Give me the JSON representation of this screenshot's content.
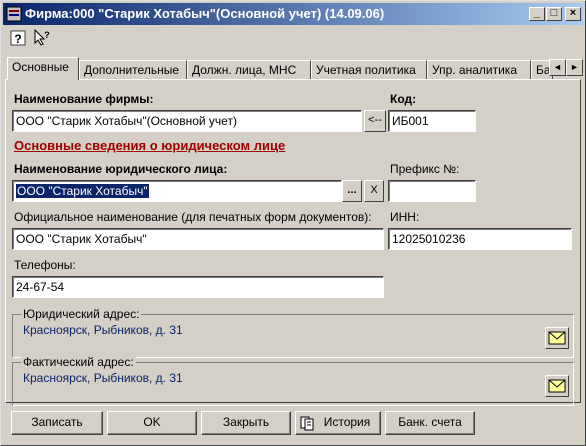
{
  "window": {
    "title": "Фирма:000 \"Старик Хотабыч\"(Основной учет) (14.09.06)"
  },
  "toolbar": {
    "help_icon": "question-icon",
    "whatsthis_icon": "pointer-question-icon"
  },
  "tabs": [
    {
      "label": "Основные",
      "active": true
    },
    {
      "label": "Дополнительные",
      "active": false
    },
    {
      "label": "Должн. лица, МНС",
      "active": false
    },
    {
      "label": "Учетная политика",
      "active": false
    },
    {
      "label": "Упр. аналитика",
      "active": false
    },
    {
      "label": "Ба",
      "active": false
    }
  ],
  "form": {
    "firm_name_label": "Наименование фирмы:",
    "firm_name_value": "ООО \"Старик Хотабыч\"(Основной учет)",
    "copy_button": "<--",
    "code_label": "Код:",
    "code_value": "ИБ001",
    "section_heading": "Основные сведения о юридическом лице",
    "legal_name_label": "Наименование юридического лица:",
    "legal_name_value": "ООО \"Старик Хотабыч\"",
    "select_button": "...",
    "clear_button": "X",
    "prefix_label": "Префикс №:",
    "prefix_value": "",
    "official_name_label": "Официальное наименование (для печатных форм документов):",
    "official_name_value": "ООО \"Старик Хотабыч\"",
    "inn_label": "ИНН:",
    "inn_value": "12025010236",
    "phones_label": "Телефоны:",
    "phones_value": "24-67-54",
    "legal_address_label": "Юридический адрес:",
    "legal_address_value": "Красноярск, Рыбников, д. 31",
    "actual_address_label": "Фактический адрес:",
    "actual_address_value": "Красноярск, Рыбников, д. 31"
  },
  "buttons": {
    "save": "Записать",
    "ok": "OK",
    "close": "Закрыть",
    "history": "История",
    "bank": "Банк. счета"
  }
}
